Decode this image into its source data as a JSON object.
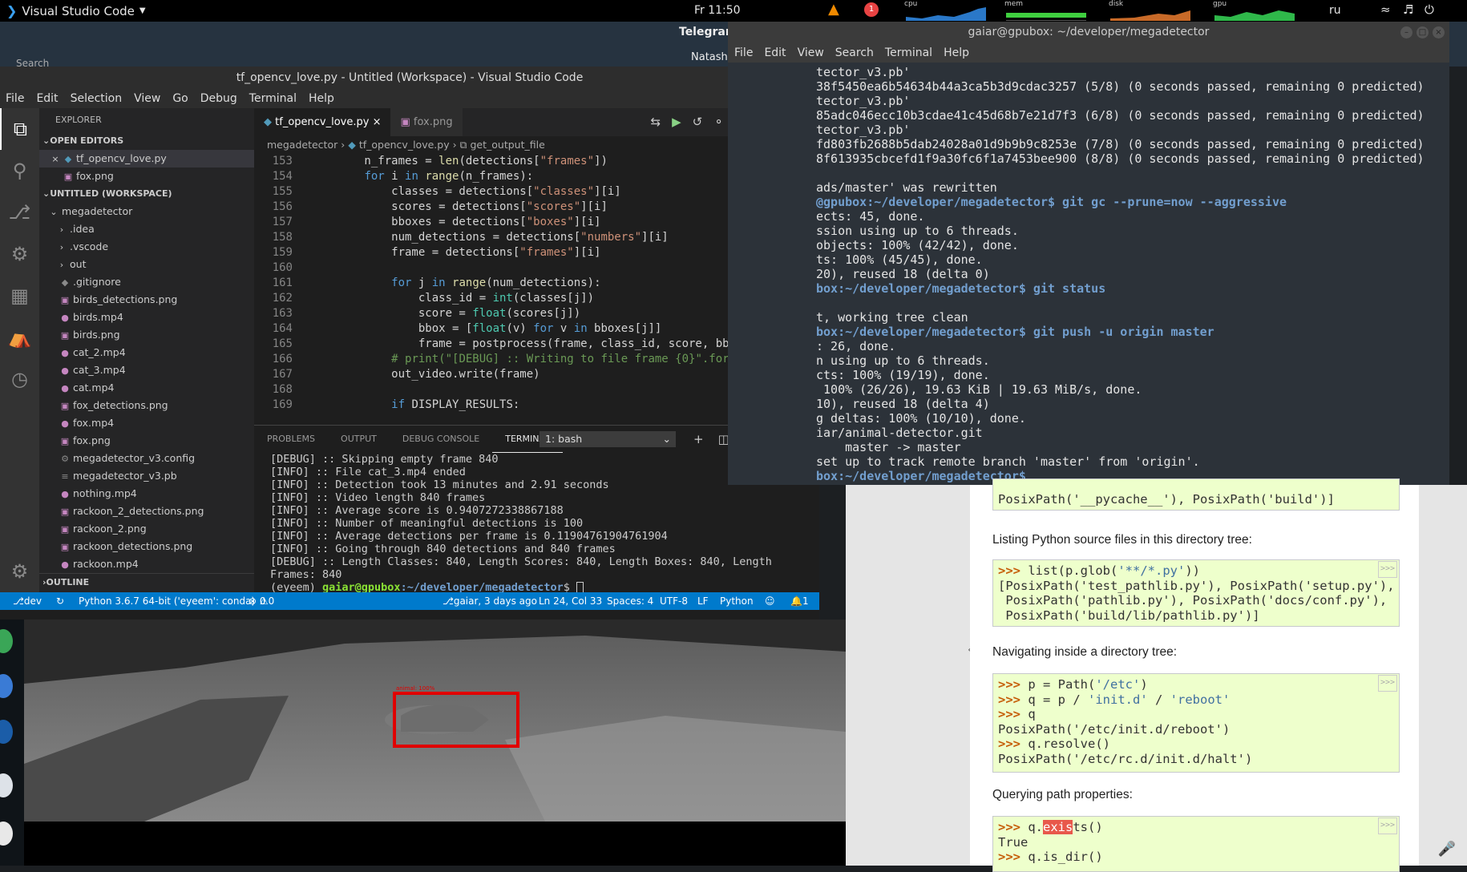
{
  "topbar": {
    "app_name": "Visual Studio Code",
    "clock": "Fr 11:50",
    "notification_count": "1",
    "meters": [
      "cpu",
      "mem",
      "disk",
      "gpu"
    ],
    "lang": "ru"
  },
  "background": {
    "telegram_title": "Telegram",
    "chat_name": "Natasha",
    "search": "Search"
  },
  "vscode": {
    "title": "tf_opencv_love.py - Untitled (Workspace) - Visual Studio Code",
    "menu": [
      "File",
      "Edit",
      "Selection",
      "View",
      "Go",
      "Debug",
      "Terminal",
      "Help"
    ],
    "explorer_header": "EXPLORER",
    "open_editors_label": "OPEN EDITORS",
    "open_editors": [
      "tf_opencv_love.py",
      "fox.png"
    ],
    "workspace_label": "UNTITLED (WORKSPACE)",
    "root_folder": "megadetector",
    "folders": [
      ".idea",
      ".vscode",
      "out"
    ],
    "files": [
      ".gitignore",
      "birds_detections.png",
      "birds.mp4",
      "birds.png",
      "cat_2.mp4",
      "cat_3.mp4",
      "cat.mp4",
      "fox_detections.png",
      "fox.mp4",
      "fox.png",
      "megadetector_v3.config",
      "megadetector_v3.pb",
      "nothing.mp4",
      "rackoon_2_detections.png",
      "rackoon_2.png",
      "rackoon_detections.png",
      "rackoon.mp4"
    ],
    "outline_label": "OUTLINE",
    "tabs": [
      "tf_opencv_love.py",
      "fox.png"
    ],
    "breadcrumb": [
      "megadetector",
      "tf_opencv_love.py",
      "get_output_file"
    ],
    "line_numbers": [
      "153",
      "154",
      "155",
      "156",
      "157",
      "158",
      "159",
      "160",
      "161",
      "162",
      "163",
      "164",
      "165",
      "166",
      "167",
      "168",
      "169"
    ],
    "panel_tabs": [
      "PROBLEMS",
      "OUTPUT",
      "DEBUG CONSOLE",
      "TERMINAL"
    ],
    "terminal_select": "1: bash",
    "terminal_lines": [
      "[DEBUG] :: Skipping empty frame 840",
      "[INFO] :: File cat_3.mp4 ended",
      "[INFO] :: Detection took 13 minutes and 2.91 seconds",
      "[INFO] :: Video length 840 frames",
      "[INFO] :: Average score is 0.9407272338867188",
      "[INFO] :: Number of meaningful detections is 100",
      "[INFO] :: Average detections per frame is 0.11904761904761904",
      "[INFO] :: Going through 840 detections and 840 frames",
      "[DEBUG] :: Length Classes: 840, Length Scores: 840, Length Boxes: 840, Length",
      "Frames: 840"
    ],
    "prompt_env": "(eyeem) ",
    "prompt_user": "gaiar@gpubox",
    "prompt_path": ":~/developer/megadetector",
    "prompt_end": "$ ",
    "status": {
      "branch": "dev",
      "interpreter": "Python 3.6.7 64-bit ('eyeem': conda)",
      "problems": "0",
      "warnings": "0",
      "blame": "gaiar, 3 days ago",
      "position": "Ln 24, Col 33",
      "spaces": "Spaces: 4",
      "encoding": "UTF-8",
      "eol": "LF",
      "language": "Python",
      "notifications": "1"
    }
  },
  "fox_image": {
    "detection_label": "animal: 100%"
  },
  "terminal_window": {
    "title": "gaiar@gpubox: ~/developer/megadetector",
    "menu": [
      "File",
      "Edit",
      "View",
      "Search",
      "Terminal",
      "Help"
    ],
    "lines": [
      "tector_v3.pb'",
      "38f5450ea6b54634b44a3ca5b3d9cdac3257 (5/8) (0 seconds passed, remaining 0 predicted)",
      "tector_v3.pb'",
      "85adc046ecc10b3cdae41c45d68b7e21d7f3 (6/8) (0 seconds passed, remaining 0 predicted)",
      "tector_v3.pb'",
      "fd803fb2688b5dab24028a01d9b9b9c8253e (7/8) (0 seconds passed, remaining 0 predicted)",
      "8f613935cbcefd1f9a30fc6f1a7453bee900 (8/8) (0 seconds passed, remaining 0 predicted)",
      "",
      "ads/master' was rewritten",
      "@gpubox:~/developer/megadetector$ git gc --prune=now --aggressive",
      "ects: 45, done.",
      "ssion using up to 6 threads.",
      "objects: 100% (42/42), done.",
      "ts: 100% (45/45), done.",
      "20), reused 18 (delta 0)",
      "box:~/developer/megadetector$ git status",
      "",
      "t, working tree clean",
      "box:~/developer/megadetector$ git push -u origin master",
      ": 26, done.",
      "n using up to 6 threads.",
      "cts: 100% (19/19), done.",
      " 100% (26/26), 19.63 KiB | 19.63 MiB/s, done.",
      "10), reused 18 (delta 4)",
      "g deltas: 100% (10/10), done.",
      "iar/animal-detector.git",
      "    master -> master",
      "set up to track remote branch 'master' from 'origin'.",
      "box:~/developer/megadetector$ "
    ]
  },
  "browser": {
    "box0": [
      "PosixPath('__pycache__'), PosixPath('build')]"
    ],
    "para1": "Listing Python source files in this directory tree:",
    "box1": [
      ">>> list(p.glob('**/*.py'))",
      "[PosixPath('test_pathlib.py'), PosixPath('setup.py'),",
      " PosixPath('pathlib.py'), PosixPath('docs/conf.py'),",
      " PosixPath('build/lib/pathlib.py')]"
    ],
    "para2": "Navigating inside a directory tree:",
    "box2": [
      ">>> p = Path('/etc')",
      ">>> q = p / 'init.d' / 'reboot'",
      ">>> q",
      "PosixPath('/etc/init.d/reboot')",
      ">>> q.resolve()",
      "PosixPath('/etc/rc.d/init.d/halt')"
    ],
    "para3": "Querying path properties:",
    "box3": [
      ">>> q.exists()",
      "True",
      ">>> q.is_dir()"
    ],
    "copy_label": ">>>",
    "sidebar_arrow": "«"
  },
  "colors": {
    "vscode_status": "#007acc",
    "detection_box": "#e00000",
    "code_box": "#eeffcc"
  }
}
